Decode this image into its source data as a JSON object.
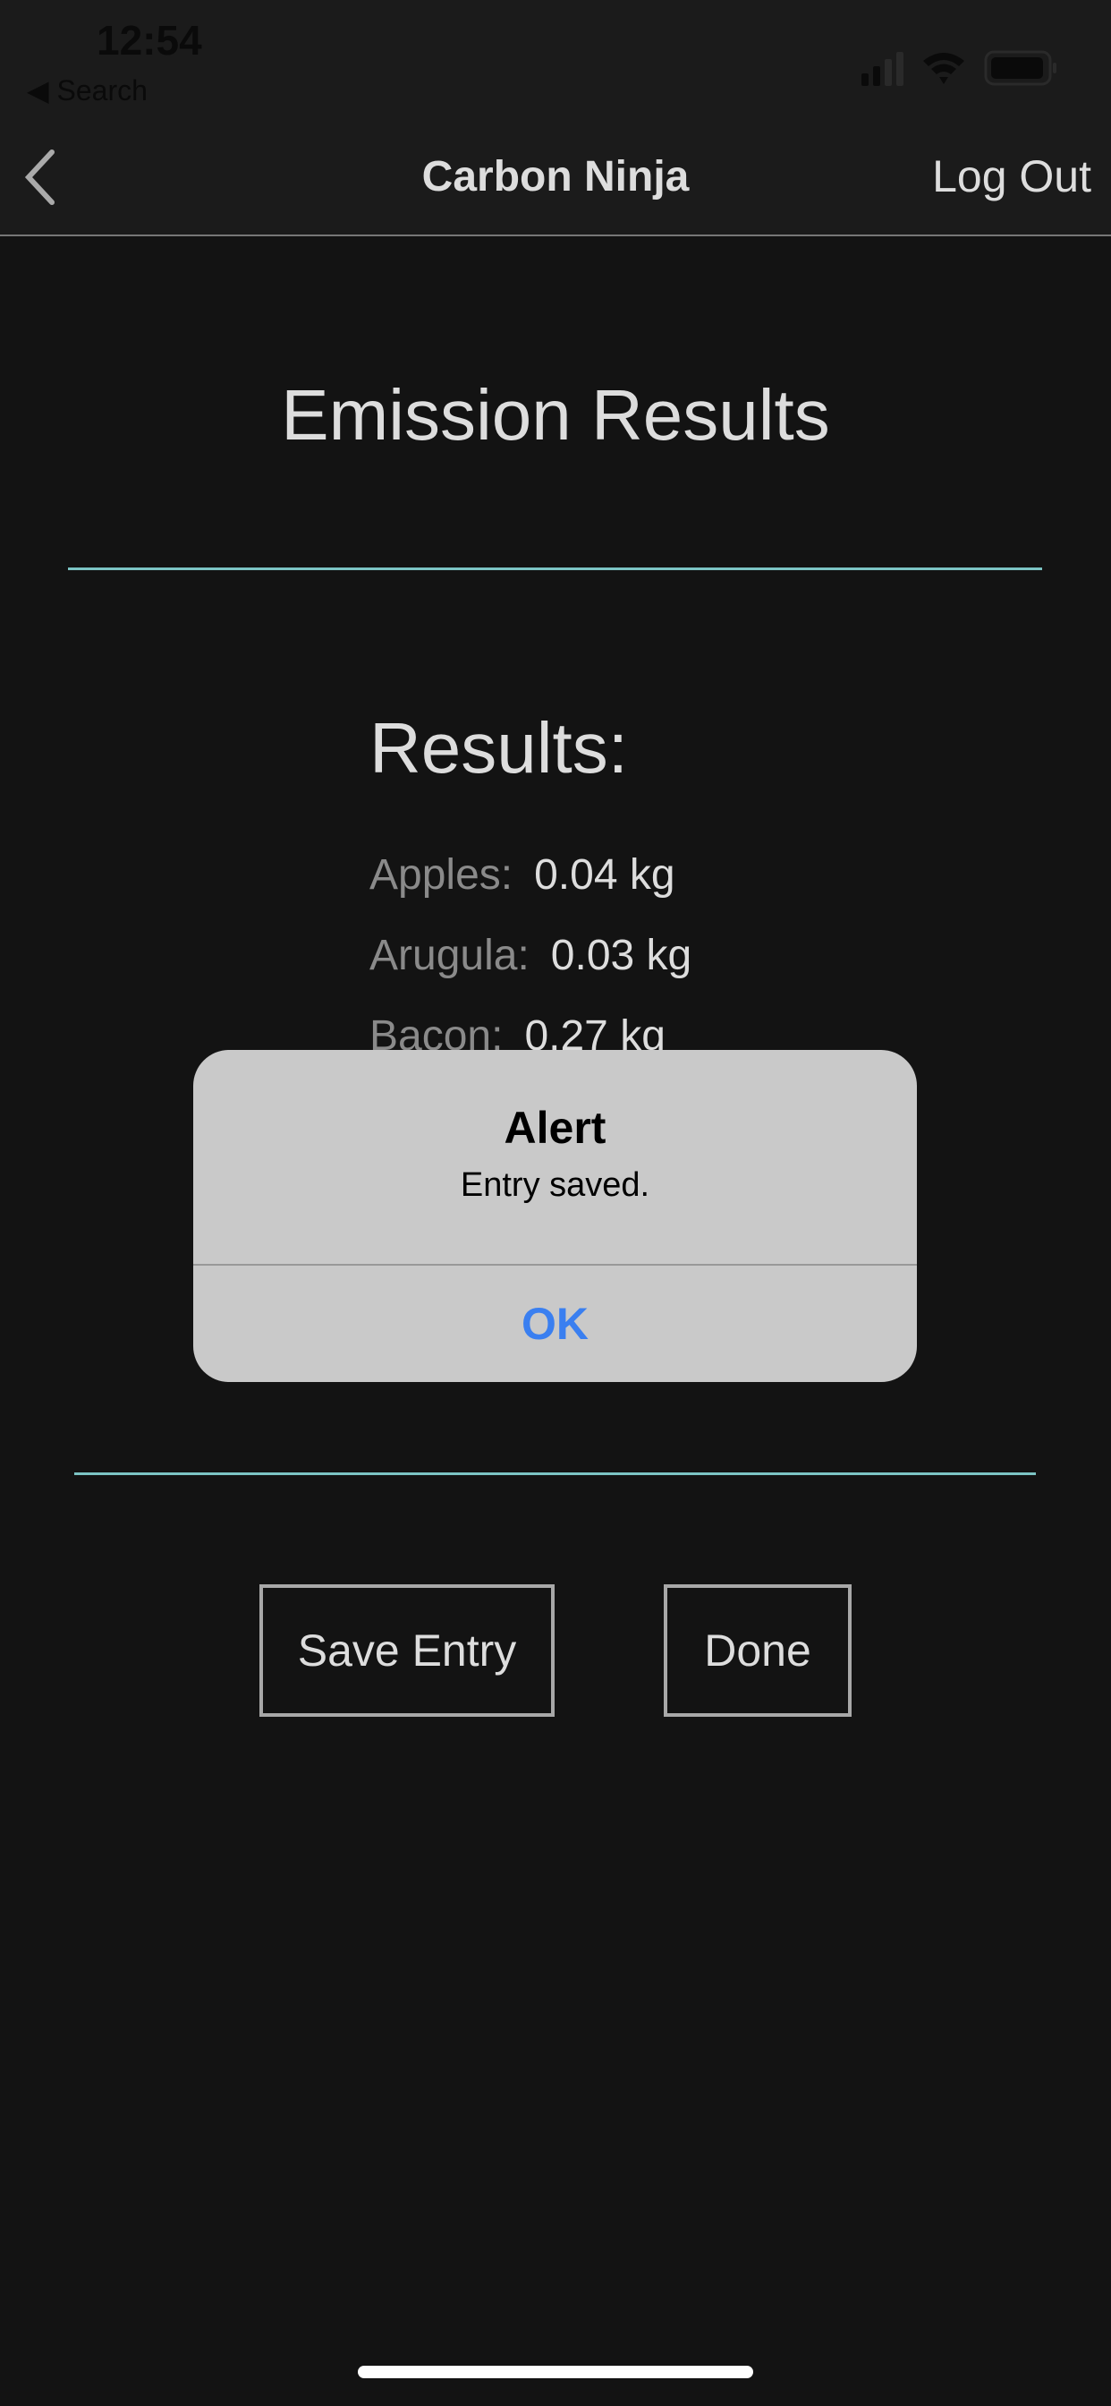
{
  "status_bar": {
    "time": "12:54",
    "back_app": "Search"
  },
  "nav": {
    "title": "Carbon Ninja",
    "logout_label": "Log Out"
  },
  "page": {
    "heading": "Emission Results",
    "results_title": "Results:",
    "results": [
      {
        "label": "Apples:",
        "value": "0.04 kg"
      },
      {
        "label": "Arugula:",
        "value": "0.03 kg"
      },
      {
        "label": "Bacon:",
        "value": "0.27 kg"
      }
    ],
    "save_label": "Save Entry",
    "done_label": "Done"
  },
  "alert": {
    "title": "Alert",
    "message": "Entry saved.",
    "ok_label": "OK"
  },
  "colors": {
    "accent_rule": "#7cc4c4",
    "alert_button": "#3a7ff0"
  }
}
